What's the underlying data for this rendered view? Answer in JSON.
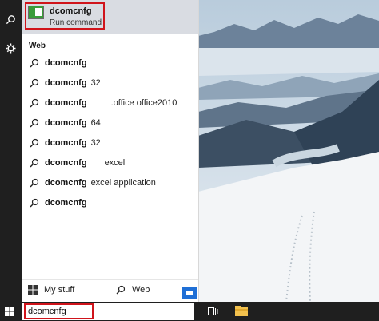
{
  "search": {
    "query": "dcomcnfg"
  },
  "best_match": {
    "title": "dcomcnfg",
    "subtitle": "Run command"
  },
  "section_label": "Web",
  "results": [
    {
      "term": "dcomcnfg",
      "rest": ""
    },
    {
      "term": "dcomcnfg",
      "rest": "32"
    },
    {
      "term": "dcomcnfg",
      "rest": ".office office2010"
    },
    {
      "term": "dcomcnfg",
      "rest": "64"
    },
    {
      "term": "dcomcnfg",
      "rest": "32"
    },
    {
      "term": "dcomcnfg",
      "rest": "excel"
    },
    {
      "term": "dcomcnfg",
      "rest": "excel application"
    },
    {
      "term": "dcomcnfg",
      "rest": ""
    }
  ],
  "bottom": {
    "my_stuff": "My stuff",
    "web": "Web"
  },
  "icons": {
    "rail": [
      "search-icon",
      "gear-icon"
    ],
    "taskbar": [
      "windows-icon",
      "task-view-icon",
      "file-explorer-icon"
    ],
    "result": "search-icon"
  },
  "colors": {
    "highlight_box": "#d0141b",
    "accent": "#1f6fd6",
    "best_match_bg": "#d9dce2"
  }
}
